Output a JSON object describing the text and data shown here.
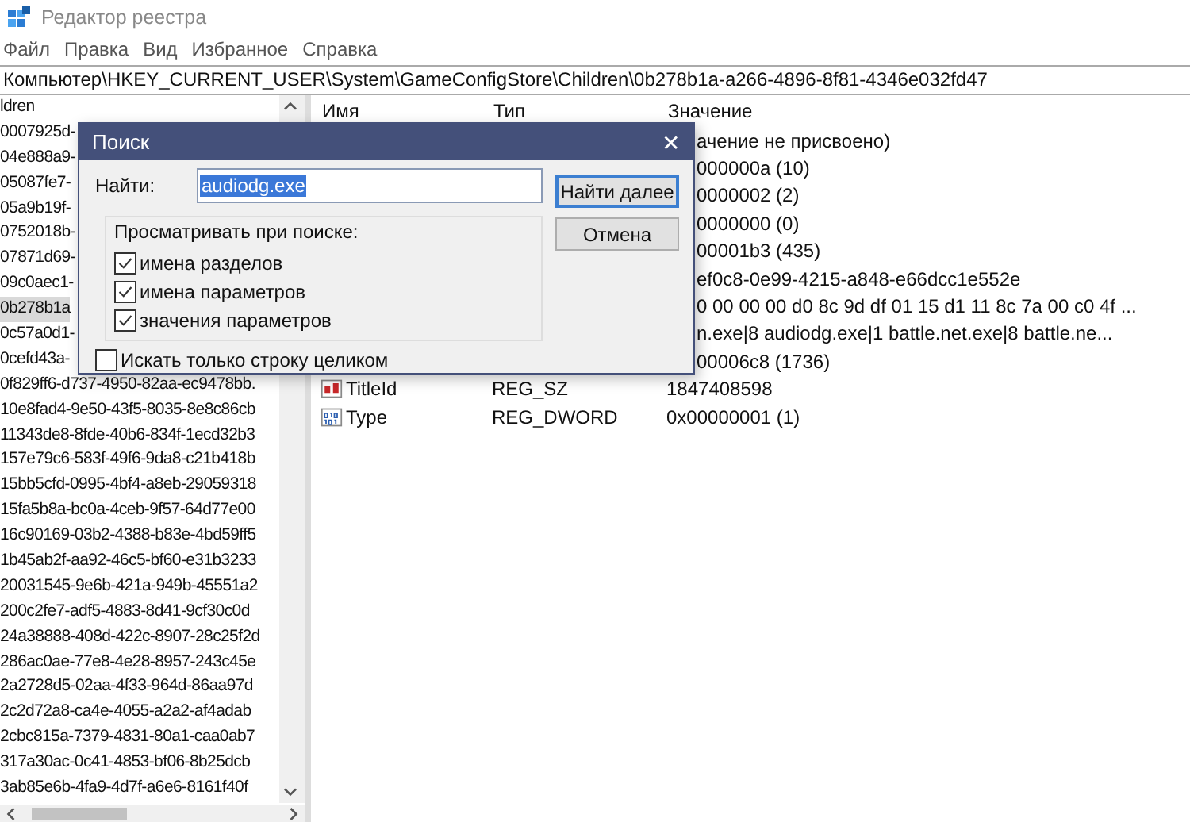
{
  "window": {
    "title": "Редактор реестра"
  },
  "menu": [
    "Файл",
    "Правка",
    "Вид",
    "Избранное",
    "Справка"
  ],
  "address": "Компьютер\\HKEY_CURRENT_USER\\System\\GameConfigStore\\Children\\0b278b1a-a266-4896-8f81-4346e032fd47",
  "tree": {
    "items": [
      {
        "label": "ldren",
        "selected": false
      },
      {
        "label": "0007925d-",
        "selected": false
      },
      {
        "label": "04e888a9-",
        "selected": false
      },
      {
        "label": "05087fe7-",
        "selected": false
      },
      {
        "label": "05a9b19f-",
        "selected": false
      },
      {
        "label": "0752018b-",
        "selected": false
      },
      {
        "label": "07871d69-",
        "selected": false
      },
      {
        "label": "09c0aec1-",
        "selected": false
      },
      {
        "label": "0b278b1a",
        "selected": true
      },
      {
        "label": "0c57a0d1-",
        "selected": false
      },
      {
        "label": "0cefd43a-",
        "selected": false
      },
      {
        "label": "0f829ff6-d737-4950-82aa-ec9478bb.",
        "selected": false
      },
      {
        "label": "10e8fad4-9e50-43f5-8035-8e8c86cb",
        "selected": false
      },
      {
        "label": "11343de8-8fde-40b6-834f-1ecd32b3",
        "selected": false
      },
      {
        "label": "157e79c6-583f-49f6-9da8-c21b418b",
        "selected": false
      },
      {
        "label": "15bb5cfd-0995-4bf4-a8eb-29059318",
        "selected": false
      },
      {
        "label": "15fa5b8a-bc0a-4ceb-9f57-64d77e00",
        "selected": false
      },
      {
        "label": "16c90169-03b2-4388-b83e-4bd59ff5",
        "selected": false
      },
      {
        "label": "1b45ab2f-aa92-46c5-bf60-e31b3233",
        "selected": false
      },
      {
        "label": "20031545-9e6b-421a-949b-45551a2",
        "selected": false
      },
      {
        "label": "200c2fe7-adf5-4883-8d41-9cf30c0d",
        "selected": false
      },
      {
        "label": "24a38888-408d-422c-8907-28c25f2d",
        "selected": false
      },
      {
        "label": "286ac0ae-77e8-4e28-8957-243c45e",
        "selected": false
      },
      {
        "label": "2a2728d5-02aa-4f33-964d-86aa97d",
        "selected": false
      },
      {
        "label": "2c2d72a8-ca4e-4055-a2a2-af4adab",
        "selected": false
      },
      {
        "label": "2cbc815a-7379-4831-80a1-caa0ab7",
        "selected": false
      },
      {
        "label": "317a30ac-0c41-4853-bf06-8b25dcb",
        "selected": false
      },
      {
        "label": "3ab85e6b-4fa9-4d7f-a6e6-8161f40f",
        "selected": false
      }
    ]
  },
  "values": {
    "columns": [
      "Имя",
      "Тип",
      "Значение"
    ],
    "rows": [
      {
        "kind": "partial",
        "data": "ачение не присвоено)"
      },
      {
        "kind": "partial",
        "data": "000000a (10)"
      },
      {
        "kind": "partial",
        "data": "0000002 (2)"
      },
      {
        "kind": "partial",
        "data": "0000000 (0)"
      },
      {
        "kind": "partial",
        "data": "00001b3 (435)"
      },
      {
        "kind": "partial",
        "data": "ef0c8-0e99-4215-a848-e66dcc1e552e"
      },
      {
        "kind": "partial",
        "data": "0 00 00 00 d0 8c 9d df 01 15 d1 11 8c 7a 00 c0 4f ..."
      },
      {
        "kind": "partial",
        "data": "n.exe|8 audiodg.exe|1 battle.net.exe|8 battle.ne..."
      },
      {
        "kind": "partial",
        "data": "00006c8 (1736)"
      },
      {
        "kind": "string",
        "name": "TitleId",
        "type": "REG_SZ",
        "data": "1847408598"
      },
      {
        "kind": "number",
        "name": "Type",
        "type": "REG_DWORD",
        "data": "0x00000001 (1)"
      }
    ]
  },
  "dialog": {
    "title": "Поиск",
    "close": "✕",
    "find_label": "Найти:",
    "find_value": "audiodg.exe",
    "group_label": "Просматривать при поиске:",
    "options": [
      {
        "label": "имена разделов",
        "checked": true
      },
      {
        "label": "имена параметров",
        "checked": true
      },
      {
        "label": "значения параметров",
        "checked": true
      }
    ],
    "whole_string": {
      "label": "Искать только строку целиком",
      "checked": false
    },
    "buttons": [
      {
        "label": "Найти далее",
        "default": true
      },
      {
        "label": "Отмена",
        "default": false
      }
    ]
  }
}
